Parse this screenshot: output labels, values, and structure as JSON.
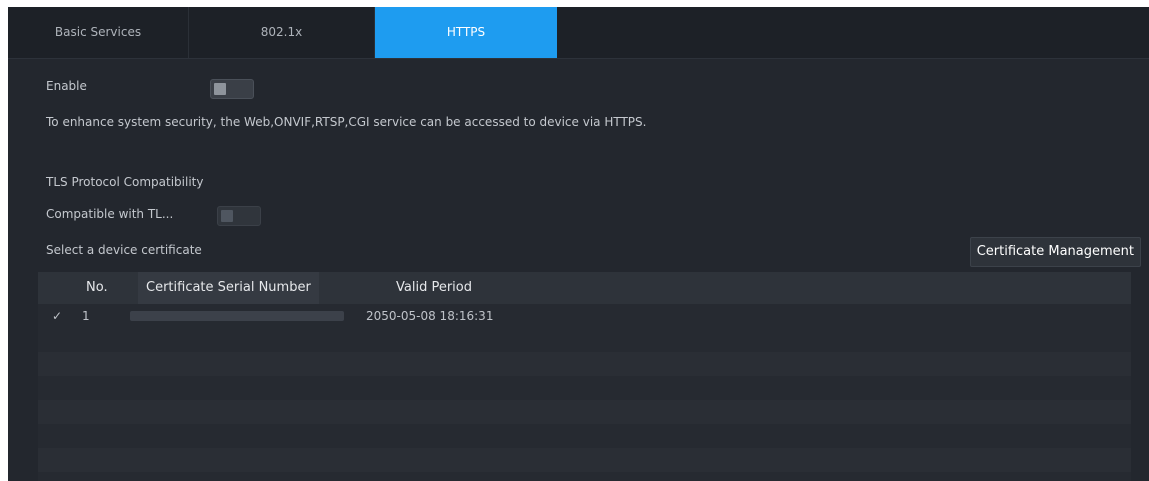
{
  "tabs": [
    {
      "label": "Basic Services"
    },
    {
      "label": "802.1x"
    },
    {
      "label": "HTTPS"
    }
  ],
  "https": {
    "enable_label": "Enable",
    "enable_on": false,
    "info_text": "To enhance system security, the Web,ONVIF,RTSP,CGI service can be accessed to device via HTTPS.",
    "tls_section_label": "TLS Protocol Compatibility",
    "compatible_label": "Compatible with TL...",
    "compatible_on": false,
    "select_cert_label": "Select a device certificate",
    "cert_mgmt_button": "Certificate Management"
  },
  "table": {
    "headers": {
      "no": "No.",
      "serial": "Certificate Serial Number",
      "valid": "Valid Period"
    },
    "rows": [
      {
        "selected": "✓",
        "no": "1",
        "serial": "",
        "valid": "2050-05-08 18:16:31"
      }
    ]
  },
  "colors": {
    "accent": "#1e9cf0",
    "background": "#23272e"
  }
}
